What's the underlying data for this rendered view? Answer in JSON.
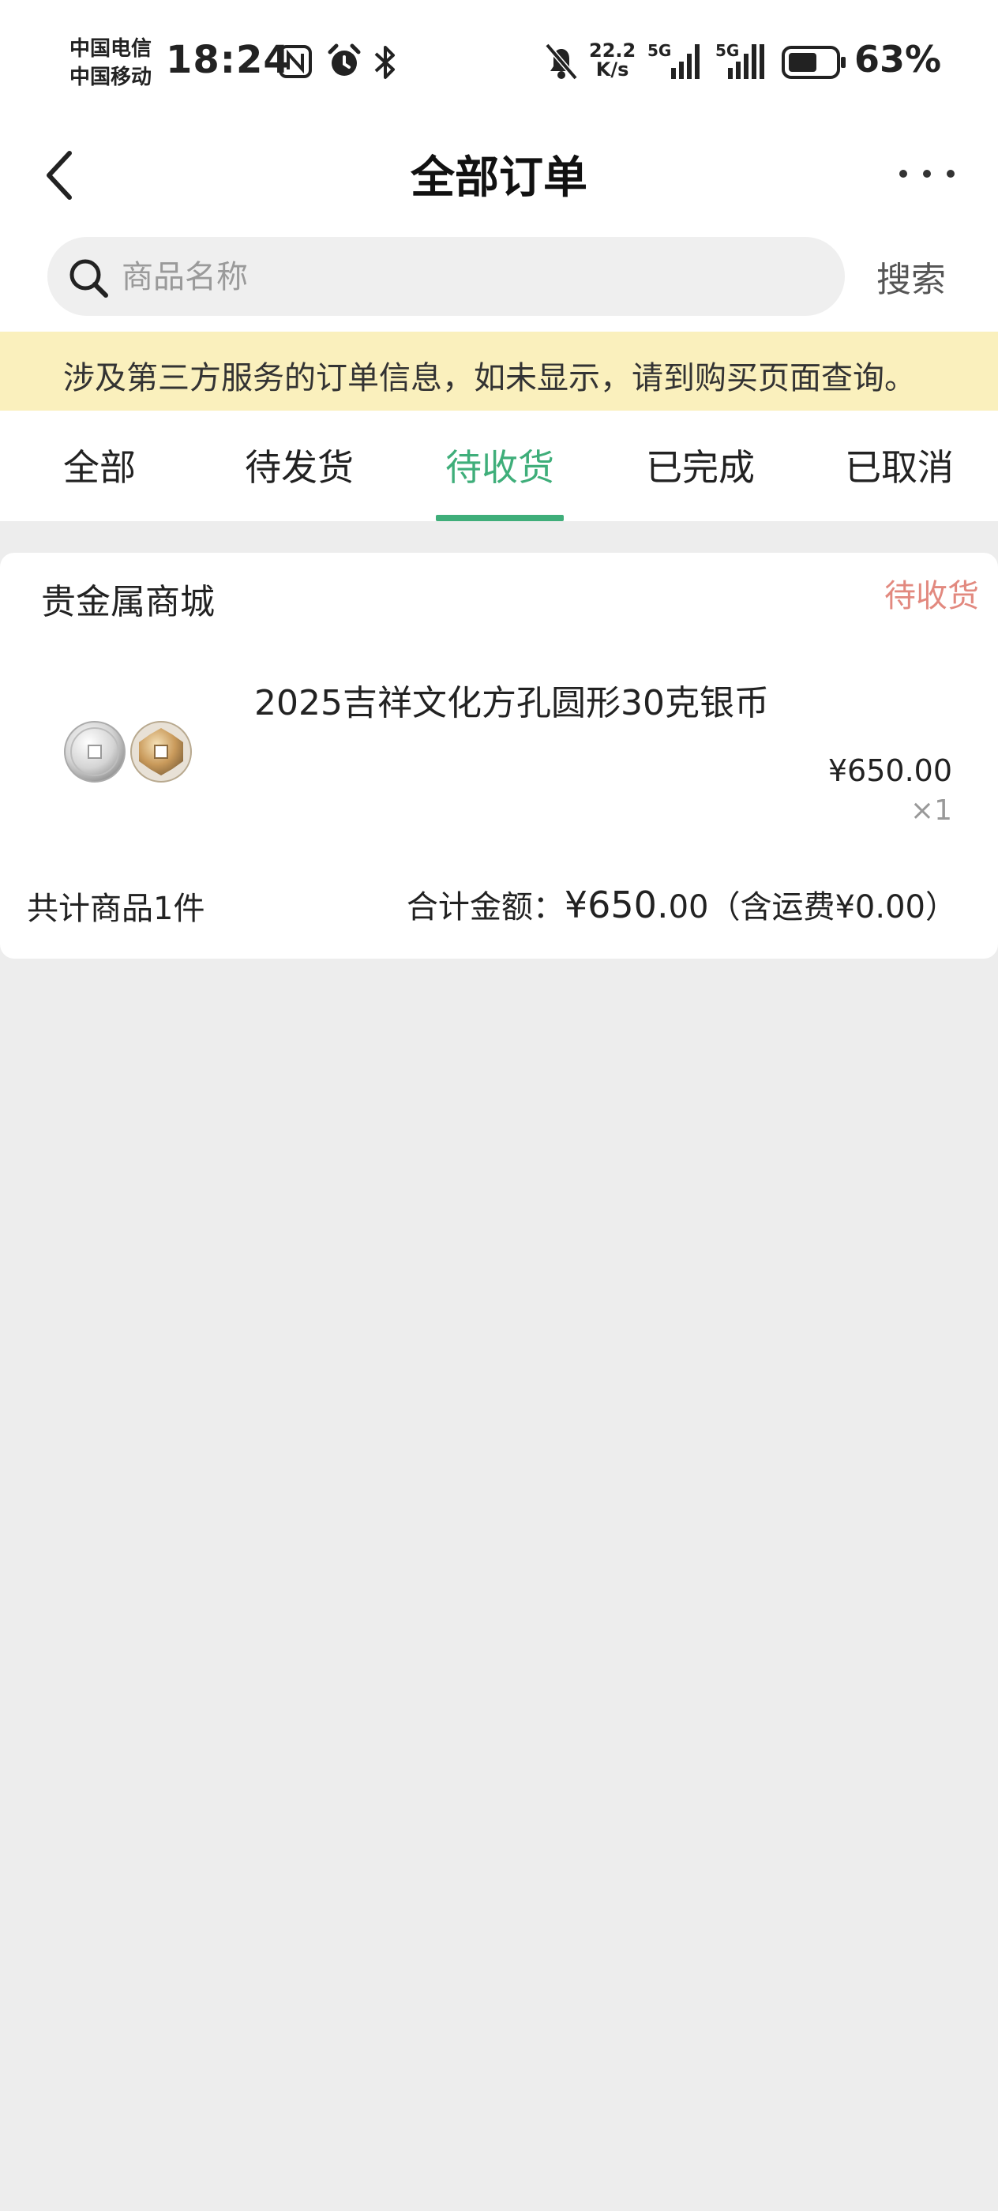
{
  "status_bar": {
    "carrier_1": "中国电信",
    "carrier_2": "中国移动",
    "time": "18:24",
    "net_speed_value": "22.2",
    "net_speed_unit": "K/s",
    "sig1_label": "5G",
    "sig2_label": "5G",
    "battery_percent": "63%",
    "battery_level": 0.63,
    "icons": [
      "nfc-icon",
      "alarm-icon",
      "bluetooth-icon",
      "mute-icon",
      "signal-icon",
      "battery-icon"
    ]
  },
  "nav": {
    "title": "全部订单"
  },
  "search": {
    "placeholder": "商品名称",
    "button_label": "搜索"
  },
  "notice": "涉及第三方服务的订单信息，如未显示，请到购买页面查询。",
  "tabs": [
    {
      "label": "全部",
      "active": false
    },
    {
      "label": "待发货",
      "active": false
    },
    {
      "label": "待收货",
      "active": true
    },
    {
      "label": "已完成",
      "active": false
    },
    {
      "label": "已取消",
      "active": false
    }
  ],
  "order": {
    "shop_name": "贵金属商城",
    "status": "待收货",
    "product_name": "2025吉祥文化方孔圆形30克银币",
    "price": "¥650.00",
    "quantity": "×1",
    "item_count": "共计商品1件",
    "total_label": "合计金额：",
    "total_amount": "¥650.",
    "total_cents": "00",
    "shipping_note": "（含运费¥0.00）"
  },
  "colors": {
    "accent_green": "#3fae7a",
    "status_red": "#e2897f",
    "notice_bg": "#faf0bd",
    "page_bg": "#ededed"
  }
}
